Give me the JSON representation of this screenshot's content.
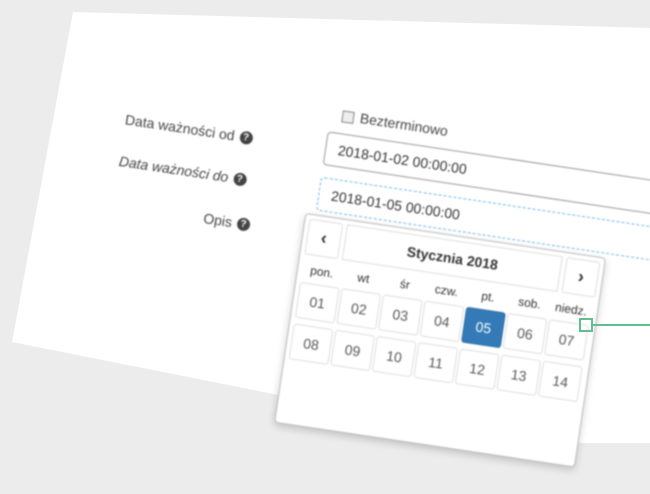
{
  "form": {
    "draft_label": "Bezterminowo",
    "valid_from_label": "Data ważności od",
    "valid_to_label": "Data ważności do",
    "description_label": "Opis",
    "valid_from_value": "2018-01-02 00:00:00",
    "valid_to_value": "2018-01-05 00:00:00",
    "help_glyph": "?"
  },
  "calendar": {
    "prev": "‹",
    "next": "›",
    "month_title": "Stycznia 2018",
    "weekdays": [
      "pon.",
      "wt",
      "śr",
      "czw.",
      "pt.",
      "sob.",
      "niedz."
    ],
    "week1": [
      "01",
      "02",
      "03",
      "04",
      "05",
      "06",
      "07"
    ],
    "week2": [
      "08",
      "09",
      "10",
      "11",
      "12",
      "13",
      "14"
    ],
    "selected_day": "05"
  },
  "colors": {
    "selected": "#337ab7",
    "marker": "#5fbf8f",
    "focus_border": "#66afe9"
  }
}
